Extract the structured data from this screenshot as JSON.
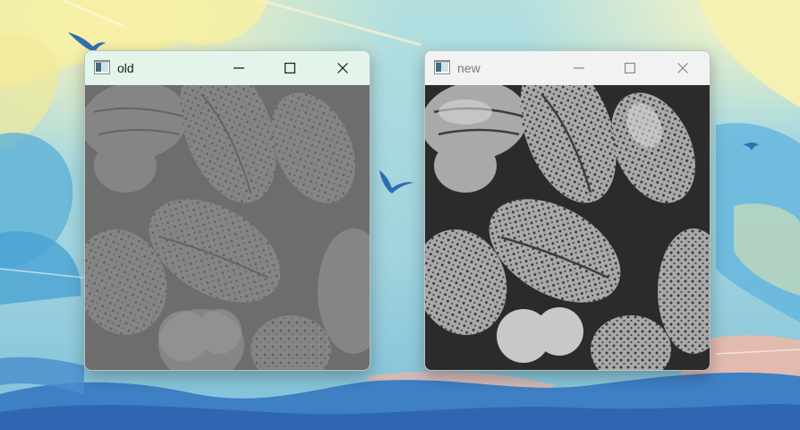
{
  "desktop": {
    "wallpaper": "sky-clouds-mountains-swallows"
  },
  "windows": [
    {
      "title": "old",
      "active": true,
      "image": "pollen-grains-low-contrast",
      "controls": {
        "minimize": "minimize-icon",
        "maximize": "maximize-icon",
        "close": "close-icon"
      }
    },
    {
      "title": "new",
      "active": false,
      "image": "pollen-grains-contrast-enhanced",
      "controls": {
        "minimize": "minimize-icon",
        "maximize": "maximize-icon",
        "close": "close-icon"
      }
    }
  ],
  "colors": {
    "active_titlebar": "#e3f4ea",
    "inactive_titlebar": "#f1f2f2",
    "old_image_base": "#6e6e6e",
    "new_image_base": "#2e2e2e"
  }
}
